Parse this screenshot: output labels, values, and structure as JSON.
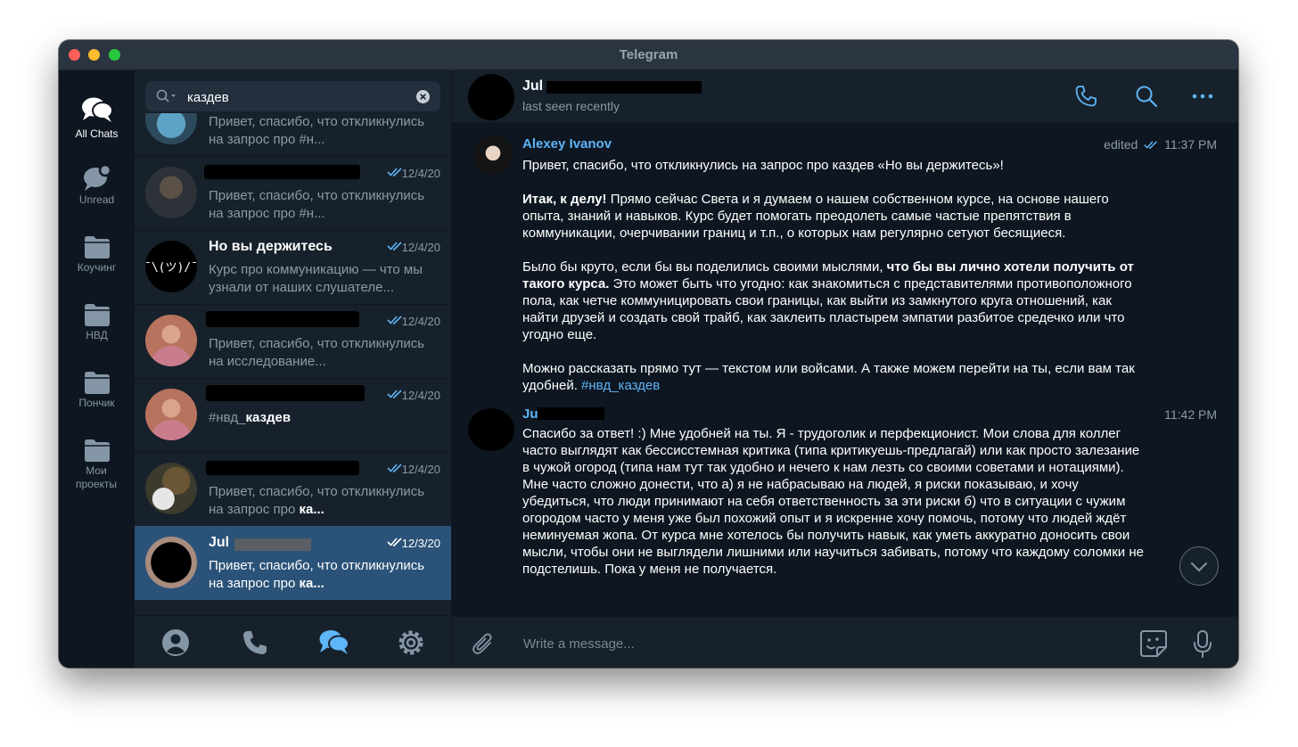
{
  "window": {
    "title": "Telegram"
  },
  "folders": [
    {
      "label": "All Chats",
      "icon": "chats-icon",
      "active": true
    },
    {
      "label": "Unread",
      "icon": "unread-chat-icon"
    },
    {
      "label": "Коучинг",
      "icon": "folder-icon"
    },
    {
      "label": "НВД",
      "icon": "folder-icon"
    },
    {
      "label": "Пончик",
      "icon": "folder-icon"
    },
    {
      "label": "Мои проекты",
      "icon": "folder-icon"
    }
  ],
  "search": {
    "value": "каздев"
  },
  "chats": [
    {
      "name": "",
      "date": "",
      "preview": "Привет, спасибо, что откликнулись на запрос про #н..."
    },
    {
      "name": "",
      "date": "12/4/20",
      "preview": "Привет, спасибо, что откликнулись на запрос про #н..."
    },
    {
      "name": "Но вы держитесь",
      "date": "12/4/20",
      "preview": "Курс про коммуникацию — что мы узнали от наших слушателе..."
    },
    {
      "name": "",
      "date": "12/4/20",
      "preview": "Привет, спасибо, что откликнулись на исследование..."
    },
    {
      "name": "",
      "date": "12/4/20",
      "preview_plain": "#нвд_",
      "preview_bold": "каздев"
    },
    {
      "name": "",
      "date": "12/4/20",
      "preview_plain": "Привет, спасибо, что откликнулись на запрос про ",
      "preview_bold": "ка..."
    },
    {
      "name": "Jul",
      "date": "12/3/20",
      "preview_plain": "Привет, спасибо, что откликнулись на запрос про ",
      "preview_bold": "ка..."
    }
  ],
  "bottom_nav": [
    "profile-icon",
    "phone-icon",
    "chats-icon",
    "settings-icon"
  ],
  "chat": {
    "name": "Jul",
    "status": "last seen recently",
    "messages": [
      {
        "author": "Alexey Ivanov",
        "edited": "edited",
        "time": "11:37 PM",
        "p1": "Привет, спасибо, что откликнулись на запрос про каздев «Но вы держитесь»!",
        "p2_bold": "Итак, к делу!",
        "p2": " Прямо сейчас Света и я думаем о нашем собственном курсе, на основе нашего опыта, знаний и навыков. Курс будет помогать преодолеть самые частые препятствия в коммуникации, очерчивании границ и т.п., о которых нам регулярно сетуют бесящиеся.",
        "p3_a": "Было бы круто, если бы вы поделились своими мыслями, ",
        "p3_bold": "что бы вы лично хотели получить от такого курса.",
        "p3_b": " Это может быть что угодно: как знакомиться с представителями противоположного пола, как четче коммуницировать свои границы, как выйти из замкнутого круга отношений, как найти друзей и создать свой трайб, как заклеить пластырем эмпатии разбитое средечко или что угодно еще.",
        "p4": "Можно рассказать прямо тут — текстом или войсами. А также можем перейти на ты, если вам так удобней. ",
        "p4_tag": "#нвд_каздев"
      },
      {
        "author": "Ju",
        "time": "11:42 PM",
        "text": "Спасибо за ответ! :) Мне удобней на ты. Я - трудоголик и перфекционист. Мои слова для коллег часто выглядят как бессисстемная критика (типа критикуешь-предлагай) или как просто залезание в чужой огород (типа нам тут так удобно и нечего к нам лезть со своими советами и нотациями). Мне часто сложно донести, что а) я не набрасываю на людей, я риски показываю, и хочу убедиться, что люди пpинимают на себя ответственность за эти риски б) что  в ситуации с чужим огородом часто у меня уже был похожий опыт и я искренне хочу помочь, потому что людей ждёт неминуемая жопа. От курса мне хотелось бы получить навык, как уметь аккуратно доносить свои мысли, чтобы они не выглядели лишними или научиться забивать, потому что каждому соломки не подстелишь. Пока у меня не получается."
      }
    ]
  },
  "composer": {
    "placeholder": "Write a message..."
  },
  "colors": {
    "accent": "#5eb5f7",
    "sidebar": "#0e1621",
    "panel": "#17212b",
    "selected": "#2b5278"
  }
}
